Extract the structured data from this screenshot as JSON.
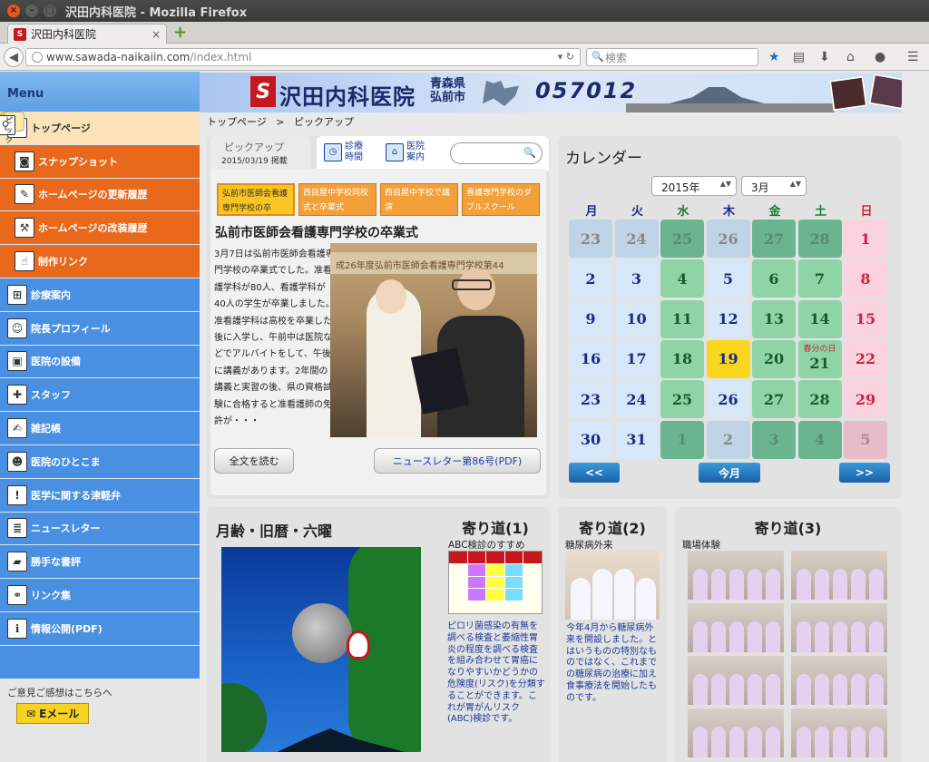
{
  "browser": {
    "window_title": "沢田内科医院 - Mozilla Firefox",
    "tab_title": "沢田内科医院",
    "url_domain": "www.sawada-naikaiin.com",
    "url_path": "/index.html",
    "search_placeholder": "検索"
  },
  "sidebar": {
    "heading": "Menu",
    "items": [
      {
        "label": "トップページ",
        "icon": "house-icon"
      },
      {
        "label": "ピックアップ",
        "icon": "magnifier-icon"
      },
      {
        "label": "スナップショット",
        "icon": "camera-icon"
      },
      {
        "label": "ホームページの更新履歴",
        "icon": "pen-icon"
      },
      {
        "label": "ホームページの改装履歴",
        "icon": "hammer-icon"
      },
      {
        "label": "制作リンク",
        "icon": "hand-icon"
      },
      {
        "label": "診療案内",
        "icon": "clinic-icon"
      },
      {
        "label": "院長プロフィール",
        "icon": "doctor-icon"
      },
      {
        "label": "医院の設備",
        "icon": "equipment-icon"
      },
      {
        "label": "スタッフ",
        "icon": "nurse-icon"
      },
      {
        "label": "雑記帳",
        "icon": "notebook-icon"
      },
      {
        "label": "医院のひとこま",
        "icon": "person-icon"
      },
      {
        "label": "医学に関する津軽弁",
        "icon": "exclamation-icon"
      },
      {
        "label": "ニュースレター",
        "icon": "newsletter-icon"
      },
      {
        "label": "勝手な書評",
        "icon": "book-icon"
      },
      {
        "label": "リンク集",
        "icon": "handshake-icon"
      },
      {
        "label": "情報公開(PDF)",
        "icon": "info-icon"
      }
    ],
    "feedback_text": "ご意見ご感想はこちらへ",
    "email_label": "Eメール"
  },
  "banner": {
    "clinic_name": "沢田内科医院",
    "area_line1": "青森県",
    "area_line2": "弘前市",
    "postal_code": "057012"
  },
  "breadcrumb": {
    "home": "トップページ",
    "separator": ">",
    "current": "ピックアップ"
  },
  "pickup": {
    "tab_title": "ピックアップ",
    "posted": "2015/03/19 掲載",
    "quick_links": [
      {
        "label": "診療時間",
        "icon": "clock-icon"
      },
      {
        "label": "医院案内",
        "icon": "map-icon"
      }
    ],
    "news_tabs": [
      "弘前市医師会看護専門学校の卒",
      "西目屋中学校同校式と卒業式",
      "西目屋中学校で講演",
      "看護専門学校のダブルスクール"
    ],
    "article_title": "弘前市医師会看護専門学校の卒業式",
    "article_body": "3月7日は弘前市医師会看護専門学校の卒業式でした。准看護学科が80人、看護学科が40人の学生が卒業しました。准看護学科は高校を卒業した後に入学し、午前中は医院などでアルバイトをして、午後に講義があります。2年間の講義と実習の後、県の資格試験に合格すると准看護師の免許が・・・",
    "photo_sign": "成26年度弘前市医師会看護専門学校第44",
    "read_more": "全文を読む",
    "newsletter_link": "ニュースレター第86号(PDF)"
  },
  "calendar": {
    "title": "カレンダー",
    "year": "2015年",
    "month": "3月",
    "weekdays": [
      "月",
      "火",
      "水",
      "木",
      "金",
      "土",
      "日"
    ],
    "weeks": [
      [
        "23",
        "24",
        "25",
        "26",
        "27",
        "28",
        "1"
      ],
      [
        "2",
        "3",
        "4",
        "5",
        "6",
        "7",
        "8"
      ],
      [
        "9",
        "10",
        "11",
        "12",
        "13",
        "14",
        "15"
      ],
      [
        "16",
        "17",
        "18",
        "19",
        "20",
        "21",
        "22"
      ],
      [
        "23",
        "24",
        "25",
        "26",
        "27",
        "28",
        "29"
      ],
      [
        "30",
        "31",
        "1",
        "2",
        "3",
        "4",
        "5"
      ]
    ],
    "holiday_label": "春分の日",
    "prev": "<<",
    "today": "今月",
    "next": ">>",
    "colors": {
      "weekday": "#d7e7f7",
      "midweek": "#8fd4a6",
      "sunday": "#fad3de",
      "today": "#f9d71e"
    }
  },
  "moon": {
    "title": "月齢・旧暦・六曜"
  },
  "yorimichi": [
    {
      "title": "寄り道(1)",
      "subtitle": "ABC検診のすすめ",
      "text": "ピロリ菌感染の有無を調べる検査と萎縮性胃炎の程度を調べる検査を組み合わせて胃癌になりやすいかどうかの危険度(リスク)を分類することができます。これが胃がんリスク(ABC)検診です。"
    },
    {
      "title": "寄り道(2)",
      "subtitle": "糖尿病外来",
      "text": "今年4月から糖尿病外来を開設しました。とはいうものの特別なものではなく、これまでの糖尿病の治療に加え食事療法を開始したものです。"
    },
    {
      "title": "寄り道(3)",
      "subtitle": "職場体験"
    }
  ]
}
